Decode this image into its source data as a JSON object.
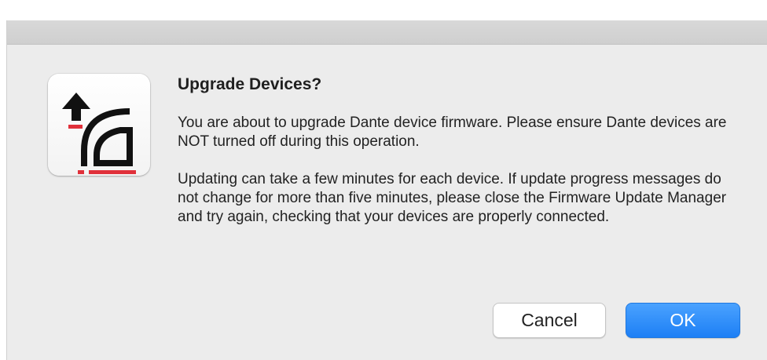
{
  "dialog": {
    "title": "Upgrade Devices?",
    "message_1": "You are about to upgrade Dante device firmware. Please ensure Dante devices are NOT turned off during this operation.",
    "message_2": "Updating can take a few minutes for each device. If update progress messages do not change for more than five minutes, please close the Firmware Update Manager and try again, checking that your devices are properly connected.",
    "icon": "firmware-update-icon",
    "buttons": {
      "cancel_label": "Cancel",
      "ok_label": "OK"
    }
  },
  "colors": {
    "accent": "#1d7ff5",
    "icon_red": "#e0303a",
    "dialog_bg": "#ececec"
  }
}
